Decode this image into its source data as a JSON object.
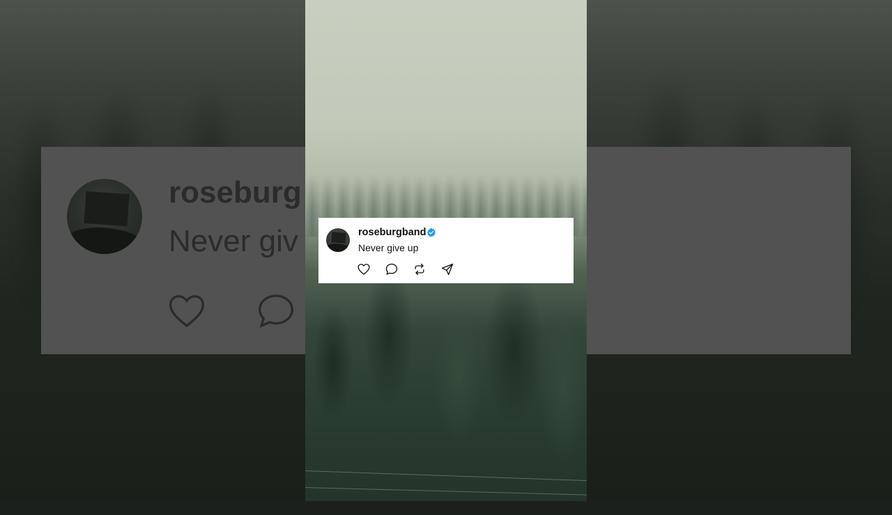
{
  "post": {
    "username": "roseburgband",
    "verified": true,
    "comment": "Never give up",
    "actions": [
      {
        "name": "like",
        "icon": "heart-icon"
      },
      {
        "name": "reply",
        "icon": "comment-icon"
      },
      {
        "name": "repost",
        "icon": "repost-icon"
      },
      {
        "name": "share",
        "icon": "send-icon"
      }
    ]
  },
  "background_card": {
    "username_visible": "roseburg",
    "comment_visible": "Never giv"
  },
  "colors": {
    "card_bg": "#ffffff",
    "verified_badge": "#1d9bf0",
    "text": "#111111"
  }
}
